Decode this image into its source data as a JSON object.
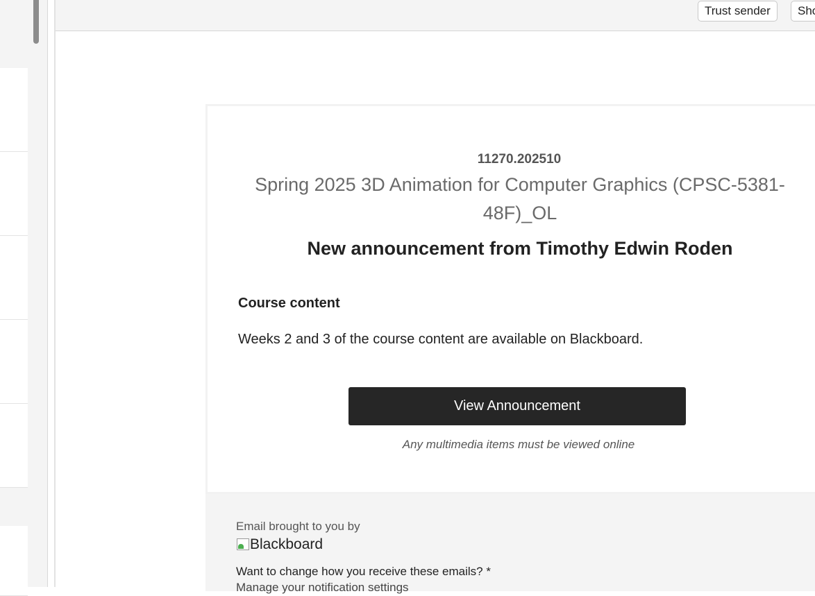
{
  "header": {
    "trust_sender_label": "Trust sender",
    "show_label": "Sho"
  },
  "email": {
    "course_id": "11270.202510",
    "course_title": "Spring 2025 3D Animation for Computer Graphics (CPSC-5381-48F)_OL",
    "announcement_heading": "New announcement from Timothy Edwin Roden",
    "content_title": "Course content",
    "content_body": "Weeks 2 and 3 of the course content are available on Blackboard.",
    "view_button_label": "View Announcement",
    "multimedia_note": "Any multimedia items must be viewed online"
  },
  "footer": {
    "brought_by": "Email brought to you by",
    "logo_alt": "Blackboard",
    "change_prompt": "Want to change how you receive these emails? *",
    "manage_link": "Manage your notification settings"
  },
  "colors": {
    "button_bg": "#262626",
    "footer_bg": "#f4f4f4",
    "header_bg": "#f4f4f4"
  }
}
